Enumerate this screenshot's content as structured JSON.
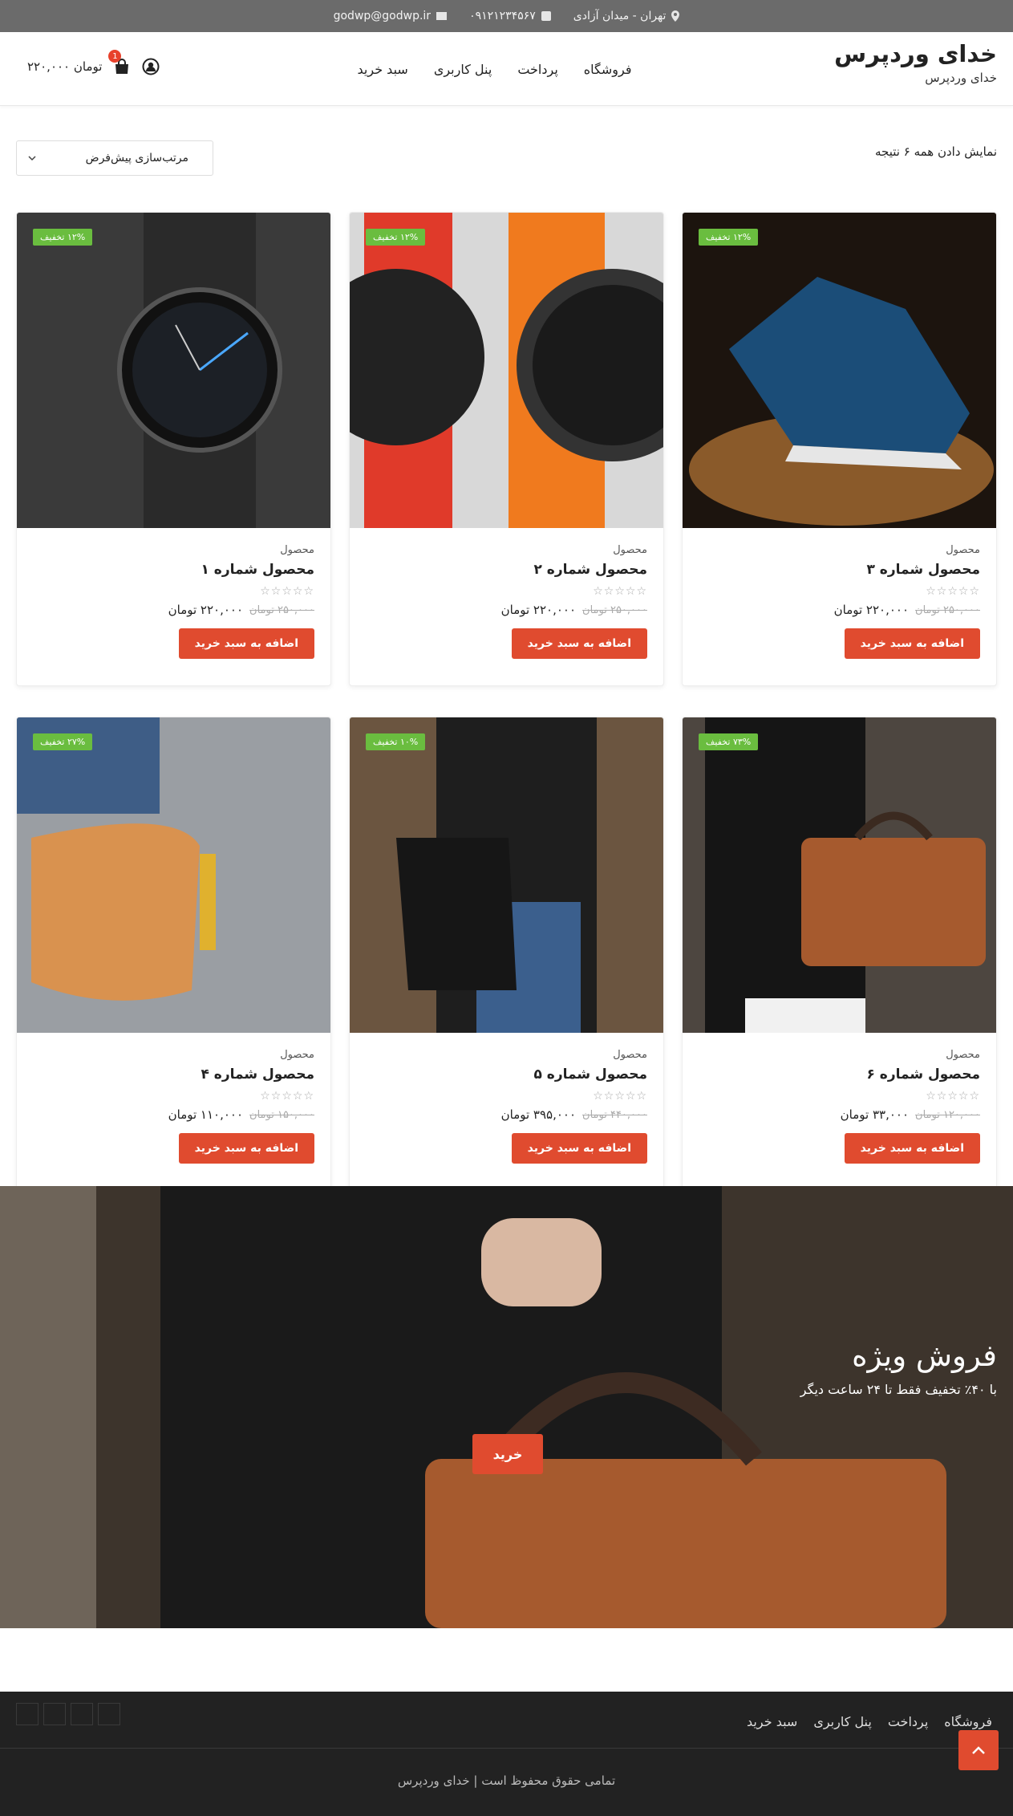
{
  "topbar": {
    "address": "تهران - میدان آزادی",
    "phone": "۰۹۱۲۱۲۳۴۵۶۷",
    "email": "godwp@godwp.ir"
  },
  "header": {
    "site_title": "خدای وردپرس",
    "tagline": "خدای وردپرس",
    "nav": [
      "فروشگاه",
      "پرداخت",
      "پنل کاربری",
      "سبد خرید"
    ],
    "cart_total": "۲۲۰,۰۰۰ تومان",
    "cart_count": "1"
  },
  "shop": {
    "results": "نمایش دادن همه ۶ نتیجه",
    "sort": "مرتب‌سازی پیش‌فرض"
  },
  "products": [
    {
      "category": "محصول",
      "name": "محصول شماره ۱",
      "old_price": "۲۵۰,۰۰۰ تومان",
      "price": "۲۲۰,۰۰۰ تومان",
      "badge": "۱۲% تخفیف",
      "button": "اضافه به سبد خرید"
    },
    {
      "category": "محصول",
      "name": "محصول شماره ۲",
      "old_price": "۲۵۰,۰۰۰ تومان",
      "price": "۲۲۰,۰۰۰ تومان",
      "badge": "۱۲% تخفیف",
      "button": "اضافه به سبد خرید"
    },
    {
      "category": "محصول",
      "name": "محصول شماره ۳",
      "old_price": "۲۵۰,۰۰۰ تومان",
      "price": "۲۲۰,۰۰۰ تومان",
      "badge": "۱۲% تخفیف",
      "button": "اضافه به سبد خرید"
    },
    {
      "category": "محصول",
      "name": "محصول شماره ۴",
      "old_price": "۱۵۰,۰۰۰ تومان",
      "price": "۱۱۰,۰۰۰ تومان",
      "badge": "۲۷% تخفیف",
      "button": "اضافه به سبد خرید"
    },
    {
      "category": "محصول",
      "name": "محصول شماره ۵",
      "old_price": "۴۴۰,۰۰۰ تومان",
      "price": "۳۹۵,۰۰۰ تومان",
      "badge": "۱۰% تخفیف",
      "button": "اضافه به سبد خرید"
    },
    {
      "category": "محصول",
      "name": "محصول شماره ۶",
      "old_price": "۱۲۰,۰۰۰ تومان",
      "price": "۳۳,۰۰۰ تومان",
      "badge": "۷۳% تخفیف",
      "button": "اضافه به سبد خرید"
    }
  ],
  "promo": {
    "title": "فروش ویژه",
    "subtitle": "با ۴۰٪ تخفیف فقط تا ۲۴ ساعت دیگر",
    "button": "خرید"
  },
  "footer": {
    "nav": [
      "فروشگاه",
      "پرداخت",
      "پنل کاربری",
      "سبد خرید"
    ],
    "copyright": "تمامی حقوق محفوظ است | خدای وردپرس"
  },
  "colors": {
    "accent": "#e04b2f",
    "badge": "#6abd3f",
    "topbar": "#6b6b6b",
    "footer": "#222222"
  }
}
